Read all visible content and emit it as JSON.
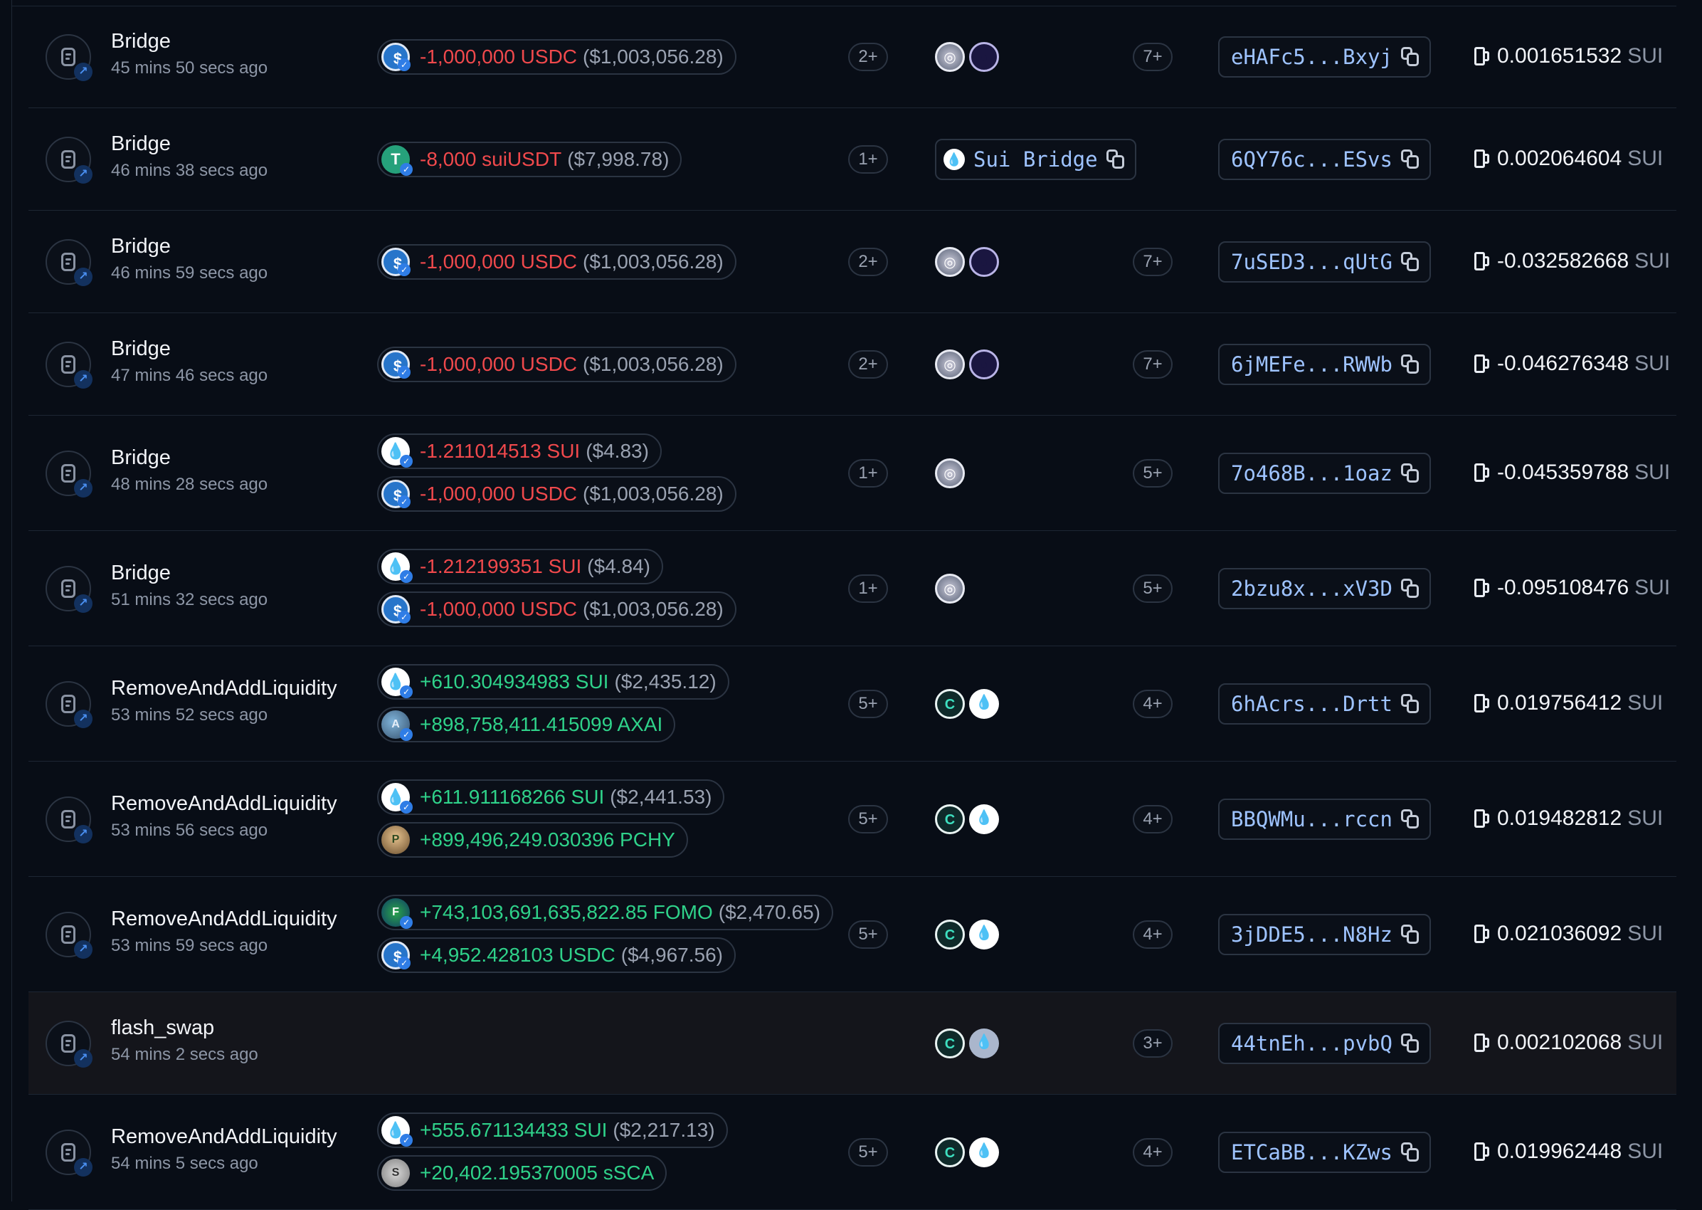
{
  "rows": [
    {
      "type": "Bridge",
      "time": "45 mins 50 secs ago",
      "balances": [
        {
          "sign": "neg",
          "coin": "usdc",
          "amount": "-1,000,000 USDC",
          "usd": "($1,003,056.28)"
        }
      ],
      "count_a": "2+",
      "protocols": [
        "wormhole",
        "ring"
      ],
      "count_b": "7+",
      "digest": "eHAFc5...Bxyj",
      "gas": "0.001651532",
      "gas_unit": "SUI"
    },
    {
      "type": "Bridge",
      "time": "46 mins 38 secs ago",
      "balances": [
        {
          "sign": "neg",
          "coin": "usdt",
          "amount": "-8,000 suiUSDT",
          "usd": "($7,998.78)"
        }
      ],
      "count_a": "1+",
      "bridge_label": "Sui Bridge",
      "digest": "6QY76c...ESvs",
      "gas": "0.002064604",
      "gas_unit": "SUI"
    },
    {
      "type": "Bridge",
      "time": "46 mins 59 secs ago",
      "balances": [
        {
          "sign": "neg",
          "coin": "usdc",
          "amount": "-1,000,000 USDC",
          "usd": "($1,003,056.28)"
        }
      ],
      "count_a": "2+",
      "protocols": [
        "wormhole",
        "ring"
      ],
      "count_b": "7+",
      "digest": "7uSED3...qUtG",
      "gas": "-0.032582668",
      "gas_unit": "SUI"
    },
    {
      "type": "Bridge",
      "time": "47 mins 46 secs ago",
      "balances": [
        {
          "sign": "neg",
          "coin": "usdc",
          "amount": "-1,000,000 USDC",
          "usd": "($1,003,056.28)"
        }
      ],
      "count_a": "2+",
      "protocols": [
        "wormhole",
        "ring"
      ],
      "count_b": "7+",
      "digest": "6jMEFe...RWWb",
      "gas": "-0.046276348",
      "gas_unit": "SUI"
    },
    {
      "type": "Bridge",
      "time": "48 mins 28 secs ago",
      "balances": [
        {
          "sign": "neg",
          "coin": "sui",
          "amount": "-1.211014513 SUI",
          "usd": "($4.83)"
        },
        {
          "sign": "neg",
          "coin": "usdc",
          "amount": "-1,000,000 USDC",
          "usd": "($1,003,056.28)"
        }
      ],
      "count_a": "1+",
      "protocols": [
        "wormhole"
      ],
      "count_b": "5+",
      "digest": "7o468B...1oaz",
      "gas": "-0.045359788",
      "gas_unit": "SUI"
    },
    {
      "type": "Bridge",
      "time": "51 mins 32 secs ago",
      "balances": [
        {
          "sign": "neg",
          "coin": "sui",
          "amount": "-1.212199351 SUI",
          "usd": "($4.84)"
        },
        {
          "sign": "neg",
          "coin": "usdc",
          "amount": "-1,000,000 USDC",
          "usd": "($1,003,056.28)"
        }
      ],
      "count_a": "1+",
      "protocols": [
        "wormhole"
      ],
      "count_b": "5+",
      "digest": "2bzu8x...xV3D",
      "gas": "-0.095108476",
      "gas_unit": "SUI"
    },
    {
      "type": "RemoveAndAddLiquidity",
      "time": "53 mins 52 secs ago",
      "balances": [
        {
          "sign": "pos",
          "coin": "sui",
          "amount": "+610.304934983 SUI",
          "usd": "($2,435.12)"
        },
        {
          "sign": "pos",
          "coin": "axai",
          "amount": "+898,758,411.415099 AXAI",
          "usd": ""
        }
      ],
      "count_a": "5+",
      "protocols": [
        "cetus",
        "sui"
      ],
      "count_b": "4+",
      "digest": "6hAcrs...Drtt",
      "gas": "0.019756412",
      "gas_unit": "SUI"
    },
    {
      "type": "RemoveAndAddLiquidity",
      "time": "53 mins 56 secs ago",
      "balances": [
        {
          "sign": "pos",
          "coin": "sui",
          "amount": "+611.911168266 SUI",
          "usd": "($2,441.53)"
        },
        {
          "sign": "pos",
          "coin": "pchy",
          "amount": "+899,496,249.030396 PCHY",
          "usd": ""
        }
      ],
      "count_a": "5+",
      "protocols": [
        "cetus",
        "sui"
      ],
      "count_b": "4+",
      "digest": "BBQWMu...rccn",
      "gas": "0.019482812",
      "gas_unit": "SUI"
    },
    {
      "type": "RemoveAndAddLiquidity",
      "time": "53 mins 59 secs ago",
      "balances": [
        {
          "sign": "pos",
          "coin": "fomo",
          "amount": "+743,103,691,635,822.85 FOMO",
          "usd": "($2,470.65)"
        },
        {
          "sign": "pos",
          "coin": "usdc",
          "amount": "+4,952.428103 USDC",
          "usd": "($4,967.56)"
        }
      ],
      "count_a": "5+",
      "protocols": [
        "cetus",
        "sui"
      ],
      "count_b": "4+",
      "digest": "3jDDE5...N8Hz",
      "gas": "0.021036092",
      "gas_unit": "SUI"
    },
    {
      "type": "flash_swap",
      "time": "54 mins 2 secs ago",
      "highlight": true,
      "balances": [],
      "protocols": [
        "cetus",
        "sui-faded"
      ],
      "count_b": "3+",
      "digest": "44tnEh...pvbQ",
      "gas": "0.002102068",
      "gas_unit": "SUI"
    },
    {
      "type": "RemoveAndAddLiquidity",
      "time": "54 mins 5 secs ago",
      "balances": [
        {
          "sign": "pos",
          "coin": "sui",
          "amount": "+555.671134433 SUI",
          "usd": "($2,217.13)"
        },
        {
          "sign": "pos",
          "coin": "sca",
          "amount": "+20,402.195370005 sSCA",
          "usd": ""
        }
      ],
      "count_a": "5+",
      "protocols": [
        "cetus",
        "sui"
      ],
      "count_b": "4+",
      "digest": "ETCaBB...KZws",
      "gas": "0.019962448",
      "gas_unit": "SUI"
    }
  ]
}
